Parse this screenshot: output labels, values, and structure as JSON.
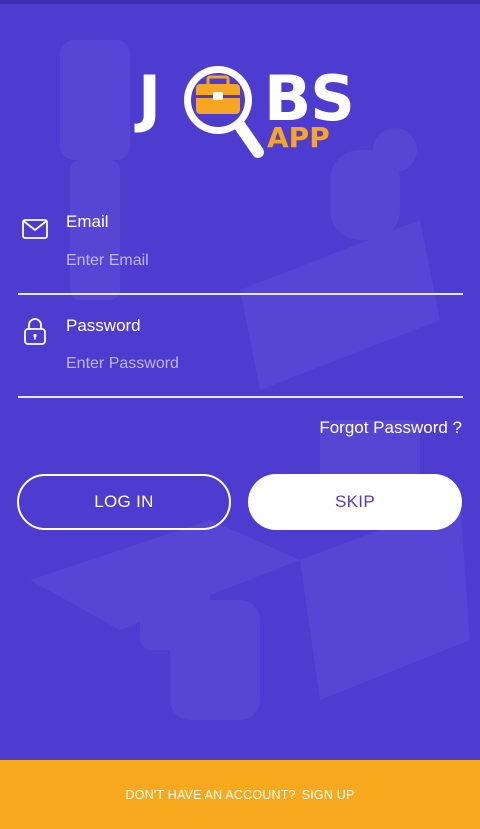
{
  "logo": {
    "part1": "J",
    "part2": "BS",
    "part3": "APP"
  },
  "email": {
    "label": "Email",
    "placeholder": "Enter Email",
    "value": ""
  },
  "password": {
    "label": "Password",
    "placeholder": "Enter Password",
    "value": ""
  },
  "forgot_password": "Forgot Password ?",
  "buttons": {
    "login": "LOG IN",
    "skip": "SKIP"
  },
  "footer": {
    "prompt": "DON'T HAVE AN ACCOUNT?",
    "signup": "SIGN UP"
  },
  "colors": {
    "background": "#4e3bd0",
    "accent": "#f6a91c",
    "white": "#ffffff"
  },
  "icons": {
    "email": "envelope-icon",
    "password": "padlock-icon",
    "logo": "briefcase-magnifier-icon"
  }
}
